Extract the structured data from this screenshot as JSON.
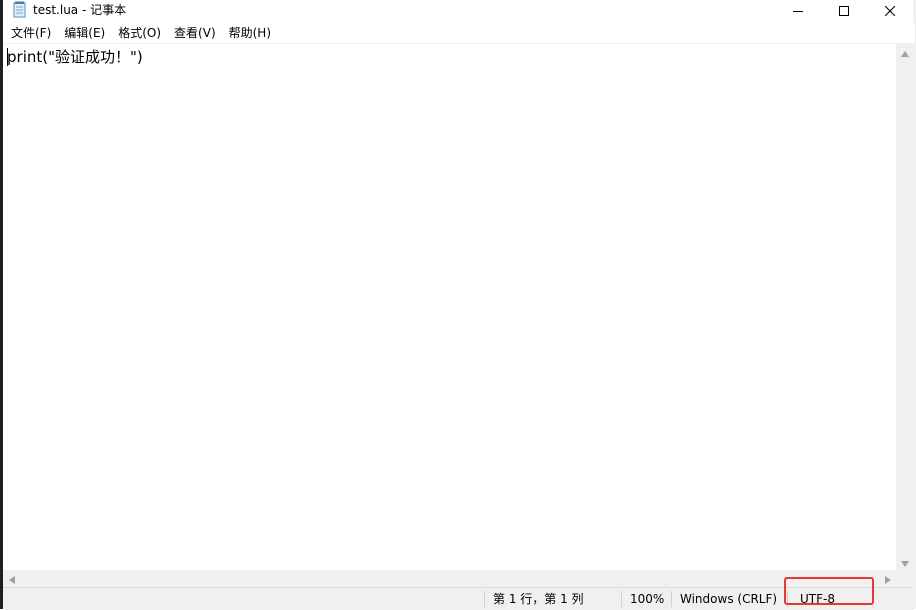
{
  "window": {
    "title": "test.lua - 记事本",
    "icon": "notepad-icon"
  },
  "controls": {
    "minimize_icon": "minimize-icon",
    "maximize_icon": "maximize-icon",
    "close_icon": "close-icon"
  },
  "menu": {
    "items": [
      {
        "label": "文件(F)"
      },
      {
        "label": "编辑(E)"
      },
      {
        "label": "格式(O)"
      },
      {
        "label": "查看(V)"
      },
      {
        "label": "帮助(H)"
      }
    ]
  },
  "editor": {
    "content": "print(\"验证成功！\")"
  },
  "statusbar": {
    "position": "第 1 行，第 1 列",
    "zoom": "100%",
    "line_ending": "Windows (CRLF)",
    "encoding": "UTF-8"
  },
  "colors": {
    "highlight": "#e53935",
    "chrome": "#f0f0f0"
  }
}
